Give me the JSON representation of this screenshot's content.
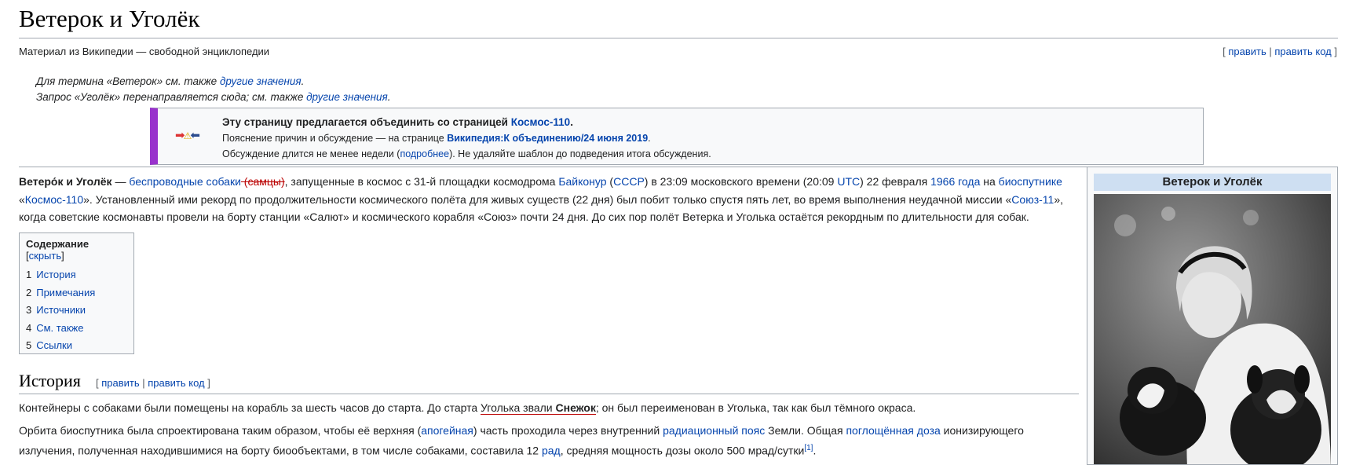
{
  "title": "Ветерок и Уголёк",
  "tagline": "Материал из Википедии — свободной энциклопедии",
  "edit": {
    "open": "[ ",
    "edit": "править",
    "sep": " | ",
    "edit_source": "править код",
    "close": " ]"
  },
  "hatnotes": [
    {
      "text": "Для термина «Ветерок» см. также ",
      "link": "другие значения",
      "end": "."
    },
    {
      "text": "Запрос «Уголёк» перенаправляется сюда; см. также ",
      "link": "другие значения",
      "end": "."
    }
  ],
  "merge": {
    "line1": "Эту страницу предлагается объединить со страницей ",
    "line1_link": "Космос-110",
    "line1_end": ".",
    "line2": "Пояснение причин и обсуждение — на странице ",
    "line2_link": "Википедия:К объединению/24 июня 2019",
    "line2_end": ".",
    "line3": "Обсуждение длится не менее недели (",
    "line3_link": "подробнее",
    "line3_end": "). Не удаляйте шаблон до подведения итога обсуждения."
  },
  "lead": {
    "bold": "Ветеро́к и Уголёк",
    "t1": " — ",
    "l1": "беспроводные собаки",
    "strike": " (самцы)",
    "t2": ", запущенные в космос с 31-й площадки космодрома ",
    "l2": "Байконур",
    "t3": " (",
    "l3": "СССР",
    "t4": ") в 23:09 московского времени (20:09 ",
    "l4": "UTC",
    "t5": ") 22 февраля ",
    "l5": "1966 года",
    "t6": " на ",
    "l6": "биоспутнике",
    "t7": " «",
    "l7": "Космос-110",
    "t8": "». Установленный ими рекорд по продолжительности космического полёта для живых существ (22 дня) был побит только спустя пять лет, во время выполнения неудачной миссии «",
    "l8": "Союз-11",
    "t9": "», когда советские космонавты провели на борту станции «Салют» и космического корабля «Союз» почти 24 дня. До сих пор полёт Ветерка и Уголька остаётся рекордным по длительности для собак."
  },
  "toc": {
    "title": "Содержание",
    "hide_open": " [",
    "hide": "скрыть",
    "hide_close": "]",
    "items": [
      {
        "num": "1",
        "label": "История"
      },
      {
        "num": "2",
        "label": "Примечания"
      },
      {
        "num": "3",
        "label": "Источники"
      },
      {
        "num": "4",
        "label": "См. также"
      },
      {
        "num": "5",
        "label": "Ссылки"
      }
    ]
  },
  "infobox": {
    "title": "Ветерок и Уголёк"
  },
  "history": {
    "heading": "История",
    "p1_t1": "Контейнеры с собаками были помещены на корабль за шесть часов до старта. До старта ",
    "p1_u1": "Уголька звали ",
    "p1_bold": "Снежок",
    "p1_t2": "; он был переименован в Уголька, так как был тёмного окраса.",
    "p2_t1": "Орбита биоспутника была спроектирована таким образом, чтобы её верхняя (",
    "p2_l1": "апогейная",
    "p2_t2": ") часть проходила через внутренний ",
    "p2_l2": "радиационный пояс",
    "p2_t3": " Земли. Общая ",
    "p2_l3": "поглощённая доза",
    "p2_t4": " ионизирующего излучения, полученная находившимися на борту биообъектами, в том числе собаками, составила 12 ",
    "p2_l4": "рад",
    "p2_t5": ", средняя мощность дозы около 500 мрад/сутки",
    "p2_sup": "[1]",
    "p2_end": "."
  }
}
